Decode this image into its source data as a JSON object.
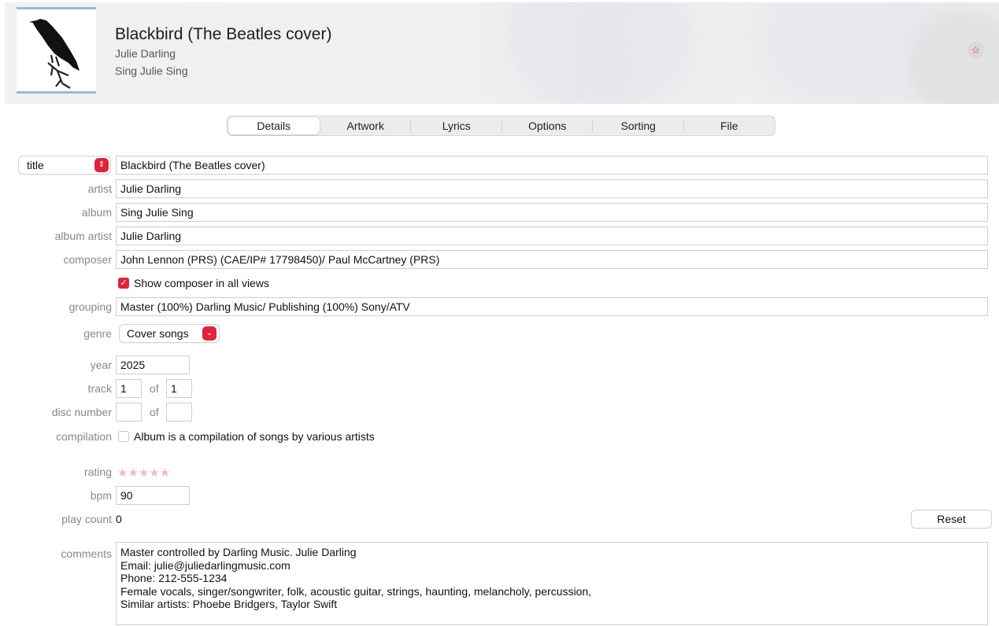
{
  "header": {
    "song_title": "Blackbird (The Beatles cover)",
    "artist": "Julie Darling",
    "album": "Sing Julie Sing",
    "love_icon": "star-icon",
    "love_symbol": "☆"
  },
  "tabs": [
    {
      "label": "Details",
      "selected": true
    },
    {
      "label": "Artwork"
    },
    {
      "label": "Lyrics"
    },
    {
      "label": "Options"
    },
    {
      "label": "Sorting"
    },
    {
      "label": "File"
    }
  ],
  "form": {
    "title_selector": "title",
    "title": "Blackbird (The Beatles cover)",
    "artist_label": "artist",
    "artist": "Julie Darling",
    "album_label": "album",
    "album": "Sing Julie Sing",
    "album_artist_label": "album artist",
    "album_artist": "Julie Darling",
    "composer_label": "composer",
    "composer": "John Lennon (PRS) (CAE/IP# 17798450)/ Paul McCartney (PRS)",
    "show_composer_label": "Show composer in all views",
    "show_composer_checked": true,
    "grouping_label": "grouping",
    "grouping": "Master (100%) Darling Music/ Publishing (100%) Sony/ATV",
    "genre_label": "genre",
    "genre": "Cover songs",
    "year_label": "year",
    "year": "2025",
    "track_label": "track",
    "track": "1",
    "of_label": "of",
    "track_total": "1",
    "disc_label": "disc number",
    "disc": "",
    "disc_total": "",
    "compilation_label": "compilation",
    "compilation_text": "Album is a compilation of songs by various artists",
    "compilation_checked": false,
    "rating_label": "rating",
    "rating": 0,
    "rating_max": 5,
    "bpm_label": "bpm",
    "bpm": "90",
    "play_count_label": "play count",
    "play_count": "0",
    "reset_label": "Reset",
    "comments_label": "comments",
    "comments_lines": [
      "Master controlled by Darling Music. Julie Darling",
      "Email: julie@juliedarlingmusic.com",
      "Phone: 212-555-1234",
      "Female vocals, singer/songwriter, folk, acoustic guitar, strings, haunting, melancholy, percussion,",
      "Similar artists: Phoebe Bridgers, Taylor Swift"
    ]
  },
  "colors": {
    "accent": "#e0233a",
    "label": "#888888"
  }
}
